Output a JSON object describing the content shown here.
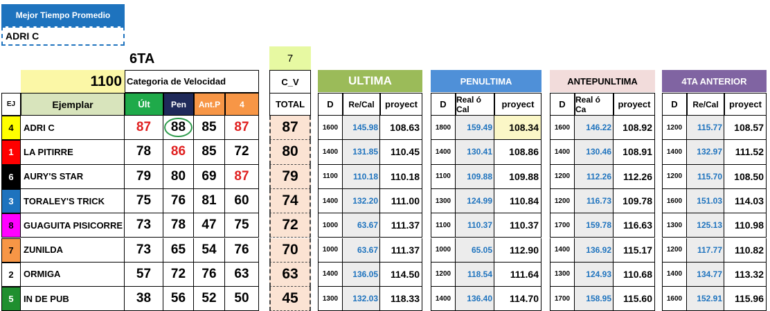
{
  "best_avg": {
    "title": "Mejor Tiempo Promedio",
    "value": "ADRI C"
  },
  "race_label": "6TA",
  "category": {
    "value": "1100",
    "label": "Categoria de Velocidad"
  },
  "cv": {
    "number": "7",
    "label": "C_V",
    "total_label": "TOTAL"
  },
  "left_headers": {
    "ej": "EJ",
    "ejemplar": "Ejemplar",
    "ult": "Últ",
    "pen": "Pen",
    "antp": "Ant.P",
    "four": "4"
  },
  "colors": {
    "ej_yellow": "#ffff00",
    "ej_red": "#ff0000",
    "ej_black": "#000000",
    "ej_blue": "#1e73be",
    "ej_magenta": "#ff00ff",
    "ej_orange": "#f79646",
    "ej_white": "#ffffff",
    "ej_green": "#1f8f2f",
    "ult_green": "#1faa4a",
    "pen_navy": "#1f2a5a",
    "antp_orange": "#f79646"
  },
  "rows": [
    {
      "ej": "4",
      "name": "ADRI C",
      "ult": "87",
      "pen": "88",
      "antp": "85",
      "four": "87",
      "total": "87"
    },
    {
      "ej": "1",
      "name": "LA PITIRRE",
      "ult": "78",
      "pen": "86",
      "antp": "85",
      "four": "72",
      "total": "80"
    },
    {
      "ej": "6",
      "name": "AURY'S STAR",
      "ult": "79",
      "pen": "80",
      "antp": "69",
      "four": "87",
      "total": "79"
    },
    {
      "ej": "3",
      "name": "TORALEY'S TRICK",
      "ult": "75",
      "pen": "76",
      "antp": "81",
      "four": "60",
      "total": "74"
    },
    {
      "ej": "8",
      "name": "GUAGUITA PISICORRE",
      "ult": "73",
      "pen": "78",
      "antp": "47",
      "four": "75",
      "total": "72"
    },
    {
      "ej": "7",
      "name": "ZUNILDA",
      "ult": "73",
      "pen": "65",
      "antp": "54",
      "four": "76",
      "total": "70"
    },
    {
      "ej": "2",
      "name": "ORMIGA",
      "ult": "57",
      "pen": "72",
      "antp": "76",
      "four": "63",
      "total": "63"
    },
    {
      "ej": "5",
      "name": "IN DE PUB",
      "ult": "38",
      "pen": "56",
      "antp": "52",
      "four": "50",
      "total": "45"
    }
  ],
  "sections": [
    {
      "title": "ULTIMA",
      "d": "D",
      "rc": "Re/Cal",
      "pr": "proyect",
      "rows": [
        [
          "1600",
          "145.98",
          "108.63"
        ],
        [
          "1400",
          "131.85",
          "110.45"
        ],
        [
          "1100",
          "110.18",
          "110.18"
        ],
        [
          "1400",
          "132.20",
          "111.00"
        ],
        [
          "1000",
          "63.67",
          "111.37"
        ],
        [
          "1000",
          "63.67",
          "111.37"
        ],
        [
          "1400",
          "136.05",
          "114.50"
        ],
        [
          "1300",
          "132.03",
          "118.33"
        ]
      ]
    },
    {
      "title": "PENULTIMA",
      "d": "D",
      "rc": "Real ó Cal",
      "pr": "proyect",
      "rows": [
        [
          "1800",
          "159.49",
          "108.34"
        ],
        [
          "1400",
          "130.41",
          "108.86"
        ],
        [
          "1100",
          "109.88",
          "109.88"
        ],
        [
          "1300",
          "124.99",
          "110.84"
        ],
        [
          "1100",
          "110.37",
          "110.37"
        ],
        [
          "1000",
          "65.05",
          "112.90"
        ],
        [
          "1200",
          "118.54",
          "111.64"
        ],
        [
          "1400",
          "136.40",
          "114.70"
        ]
      ]
    },
    {
      "title": "ANTEPUNLTIMA",
      "d": "D",
      "rc": "Real ó Ca",
      "pr": "proyect",
      "rows": [
        [
          "1600",
          "146.22",
          "108.92"
        ],
        [
          "1400",
          "130.46",
          "108.91"
        ],
        [
          "1200",
          "112.26",
          "112.26"
        ],
        [
          "1200",
          "116.73",
          "109.78"
        ],
        [
          "1700",
          "159.78",
          "116.63"
        ],
        [
          "1400",
          "136.92",
          "115.17"
        ],
        [
          "1300",
          "124.93",
          "110.68"
        ],
        [
          "1700",
          "158.95",
          "115.60"
        ]
      ]
    },
    {
      "title": "4TA ANTERIOR",
      "d": "D",
      "rc": "Re/Cal",
      "pr": "proyect",
      "rows": [
        [
          "1200",
          "115.77",
          "108.57"
        ],
        [
          "1400",
          "132.97",
          "111.52"
        ],
        [
          "1200",
          "115.70",
          "108.50"
        ],
        [
          "1600",
          "151.03",
          "114.03"
        ],
        [
          "1300",
          "125.13",
          "110.98"
        ],
        [
          "1200",
          "117.77",
          "110.82"
        ],
        [
          "1400",
          "134.77",
          "113.32"
        ],
        [
          "1600",
          "152.91",
          "115.96"
        ]
      ]
    }
  ]
}
